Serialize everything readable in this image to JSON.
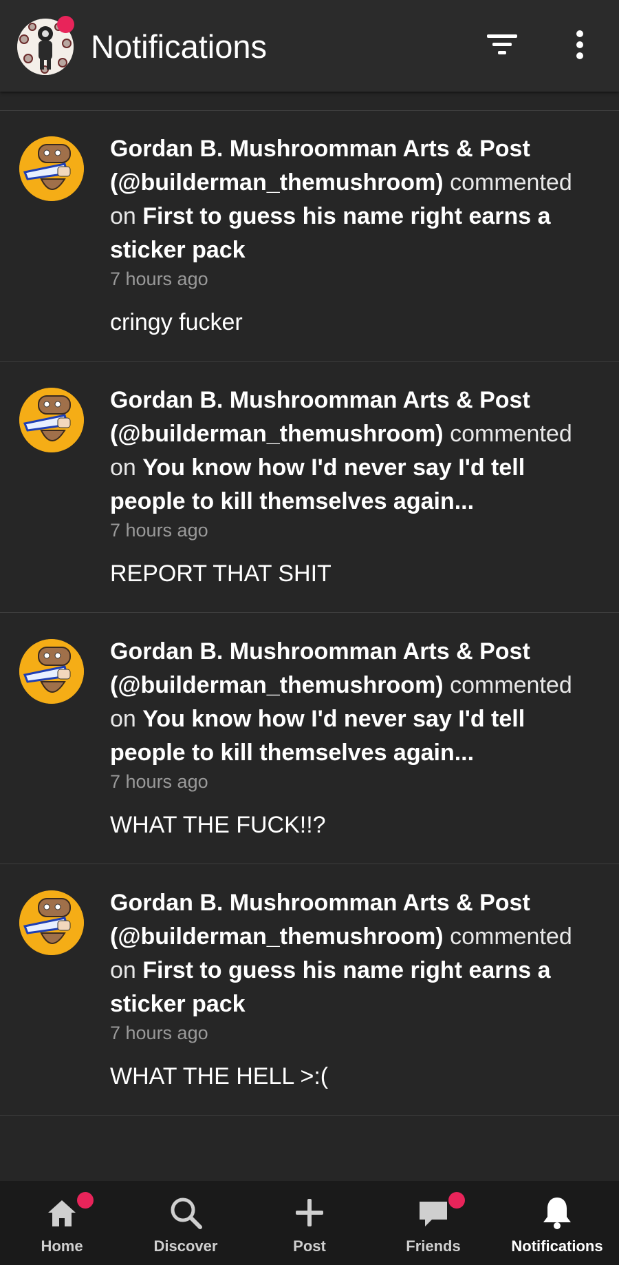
{
  "header": {
    "title": "Notifications",
    "avatar_badge_color": "#e8245a",
    "icons": [
      "filter-icon",
      "more-vertical-icon"
    ]
  },
  "notifications": [
    {
      "author": "Gordan B. Mushroomman Arts & Post (@builderman_themushroom)",
      "verb": "commented on",
      "post_title": "First to guess his name right earns a sticker pack",
      "time": "7 hours ago",
      "comment": "cringy fucker"
    },
    {
      "author": "Gordan B. Mushroomman Arts & Post (@builderman_themushroom)",
      "verb": "commented on",
      "post_title": "You know how I'd never say I'd tell people to kill themselves again...",
      "time": "7 hours ago",
      "comment": "REPORT THAT SHIT"
    },
    {
      "author": "Gordan B. Mushroomman Arts & Post (@builderman_themushroom)",
      "verb": "commented on",
      "post_title": "You know how I'd never say I'd tell people to kill themselves again...",
      "time": "7 hours ago",
      "comment": "WHAT THE FUCK!!?"
    },
    {
      "author": "Gordan B. Mushroomman Arts & Post (@builderman_themushroom)",
      "verb": "commented on",
      "post_title": "First to guess his name right earns a sticker pack",
      "time": "7 hours ago",
      "comment": "WHAT THE HELL >:("
    }
  ],
  "bottom_nav": [
    {
      "label": "Home",
      "icon": "home-icon",
      "badge": true,
      "active": false
    },
    {
      "label": "Discover",
      "icon": "search-icon",
      "badge": false,
      "active": false
    },
    {
      "label": "Post",
      "icon": "plus-icon",
      "badge": false,
      "active": false
    },
    {
      "label": "Friends",
      "icon": "chat-bubble-icon",
      "badge": true,
      "active": false
    },
    {
      "label": "Notifications",
      "icon": "bell-icon",
      "badge": false,
      "active": true
    }
  ],
  "colors": {
    "background": "#262626",
    "header": "#2b2b2b",
    "nav": "#1a1a1a",
    "accent": "#e8245a",
    "avatar_bg": "#f5ad16"
  }
}
